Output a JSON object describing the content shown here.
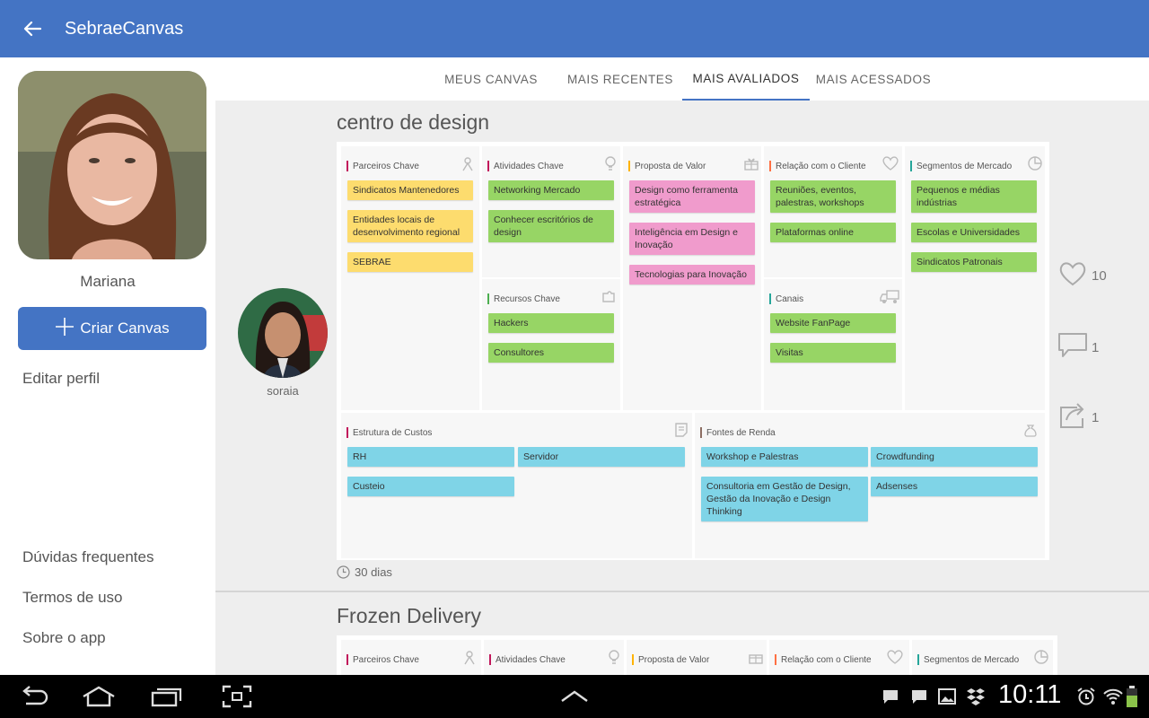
{
  "appbar": {
    "title": "SebraeCanvas"
  },
  "sidebar": {
    "user_name": "Mariana",
    "create_label": "Criar Canvas",
    "edit_profile": "Editar perfil",
    "faq": "Dúvidas frequentes",
    "terms": "Termos de uso",
    "about": "Sobre o app"
  },
  "tabs": [
    {
      "label": "MEUS CANVAS",
      "active": false
    },
    {
      "label": "MAIS RECENTES",
      "active": false
    },
    {
      "label": "MAIS AVALIADOS",
      "active": true
    },
    {
      "label": "MAIS ACESSADOS",
      "active": false
    }
  ],
  "colors": {
    "primary": "#4474c4",
    "note_yellow": "#fddc6e",
    "note_green": "#97d565",
    "note_pink": "#f09bcc",
    "note_blue": "#7fd4e7"
  },
  "cards": [
    {
      "title": "centro de design",
      "author": "soraia",
      "likes": "10",
      "comments": "1",
      "shares": "1",
      "age": "30 dias",
      "sections": {
        "parceiros": {
          "title": "Parceiros Chave",
          "notes": [
            "Sindicatos Mantenedores",
            "Entidades locais de desenvolvimento regional",
            "SEBRAE"
          ]
        },
        "atividades": {
          "title": "Atividades Chave",
          "notes": [
            "Networking Mercado",
            "Conhecer escritórios de design"
          ]
        },
        "recursos": {
          "title": "Recursos Chave",
          "notes": [
            "Hackers",
            "Consultores"
          ]
        },
        "proposta": {
          "title": "Proposta de Valor",
          "notes": [
            "Design como ferramenta estratégica",
            "Inteligência em Design e Inovação",
            "Tecnologias para Inovação"
          ]
        },
        "relacao": {
          "title": "Relação com o Cliente",
          "notes": [
            "Reuniões, eventos, palestras, workshops",
            "Plataformas online"
          ]
        },
        "canais": {
          "title": "Canais",
          "notes": [
            "Website FanPage",
            "Visitas"
          ]
        },
        "segmentos": {
          "title": "Segmentos de Mercado",
          "notes": [
            "Pequenos e médias indústrias",
            "Escolas e Universidades",
            "Sindicatos Patronais"
          ]
        },
        "custos": {
          "title": "Estrutura de Custos",
          "notes": [
            "RH",
            "Servidor",
            "Custeio"
          ]
        },
        "renda": {
          "title": "Fontes de Renda",
          "notes": [
            "Workshop e Palestras",
            "Crowdfunding",
            "Consultoria em Gestão de Design, Gestão da Inovação e Design Thinking",
            "Adsenses"
          ]
        }
      }
    },
    {
      "title": "Frozen Delivery",
      "sections": {
        "parceiros": {
          "title": "Parceiros Chave"
        },
        "atividades": {
          "title": "Atividades Chave"
        },
        "proposta": {
          "title": "Proposta de Valor"
        },
        "relacao": {
          "title": "Relação com o Cliente"
        },
        "segmentos": {
          "title": "Segmentos de Mercado"
        }
      }
    }
  ],
  "statusbar": {
    "time": "10:11"
  }
}
